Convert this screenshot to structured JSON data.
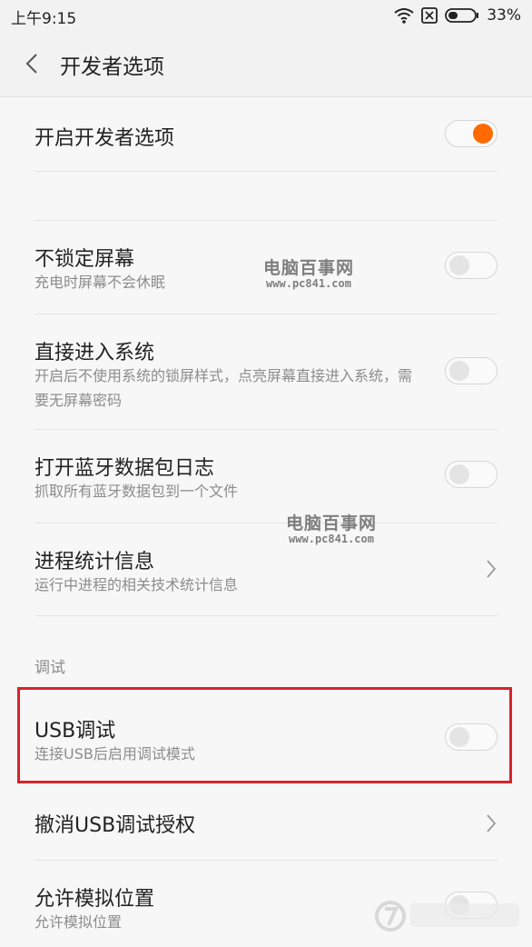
{
  "status_bar": {
    "time": "上午9:15",
    "battery": "33%"
  },
  "header": {
    "title": "开发者选项"
  },
  "rows": [
    {
      "label": "开启开发者选项",
      "toggle": "on"
    },
    {
      "label": "不锁定屏幕",
      "subtitle": "充电时屏幕不会休眠",
      "toggle": "off"
    },
    {
      "label": "直接进入系统",
      "subtitle": "开启后不使用系统的锁屏样式，点亮屏幕直接进入系统，需要无屏幕密码",
      "toggle": "off"
    },
    {
      "label": "打开蓝牙数据包日志",
      "subtitle": "抓取所有蓝牙数据包到一个文件",
      "toggle": "off"
    },
    {
      "label": "进程统计信息",
      "subtitle": "运行中进程的相关技术统计信息",
      "control": "chevron"
    },
    {
      "label": "USB调试",
      "subtitle": "连接USB后启用调试模式",
      "toggle": "off"
    },
    {
      "label": "撤消USB调试授权",
      "control": "chevron"
    },
    {
      "label": "允许模拟位置",
      "subtitle": "允许模拟位置",
      "toggle": "off"
    }
  ],
  "section_debug": "调试",
  "watermark": {
    "title": "电脑百事网",
    "url": "www.pc841.com"
  },
  "colors": {
    "accent": "#ff6a00",
    "highlight": "#d8232a"
  },
  "icons": [
    "wifi-icon",
    "sim-disabled-icon",
    "battery-icon",
    "back-arrow-icon",
    "chevron-right-icon"
  ]
}
